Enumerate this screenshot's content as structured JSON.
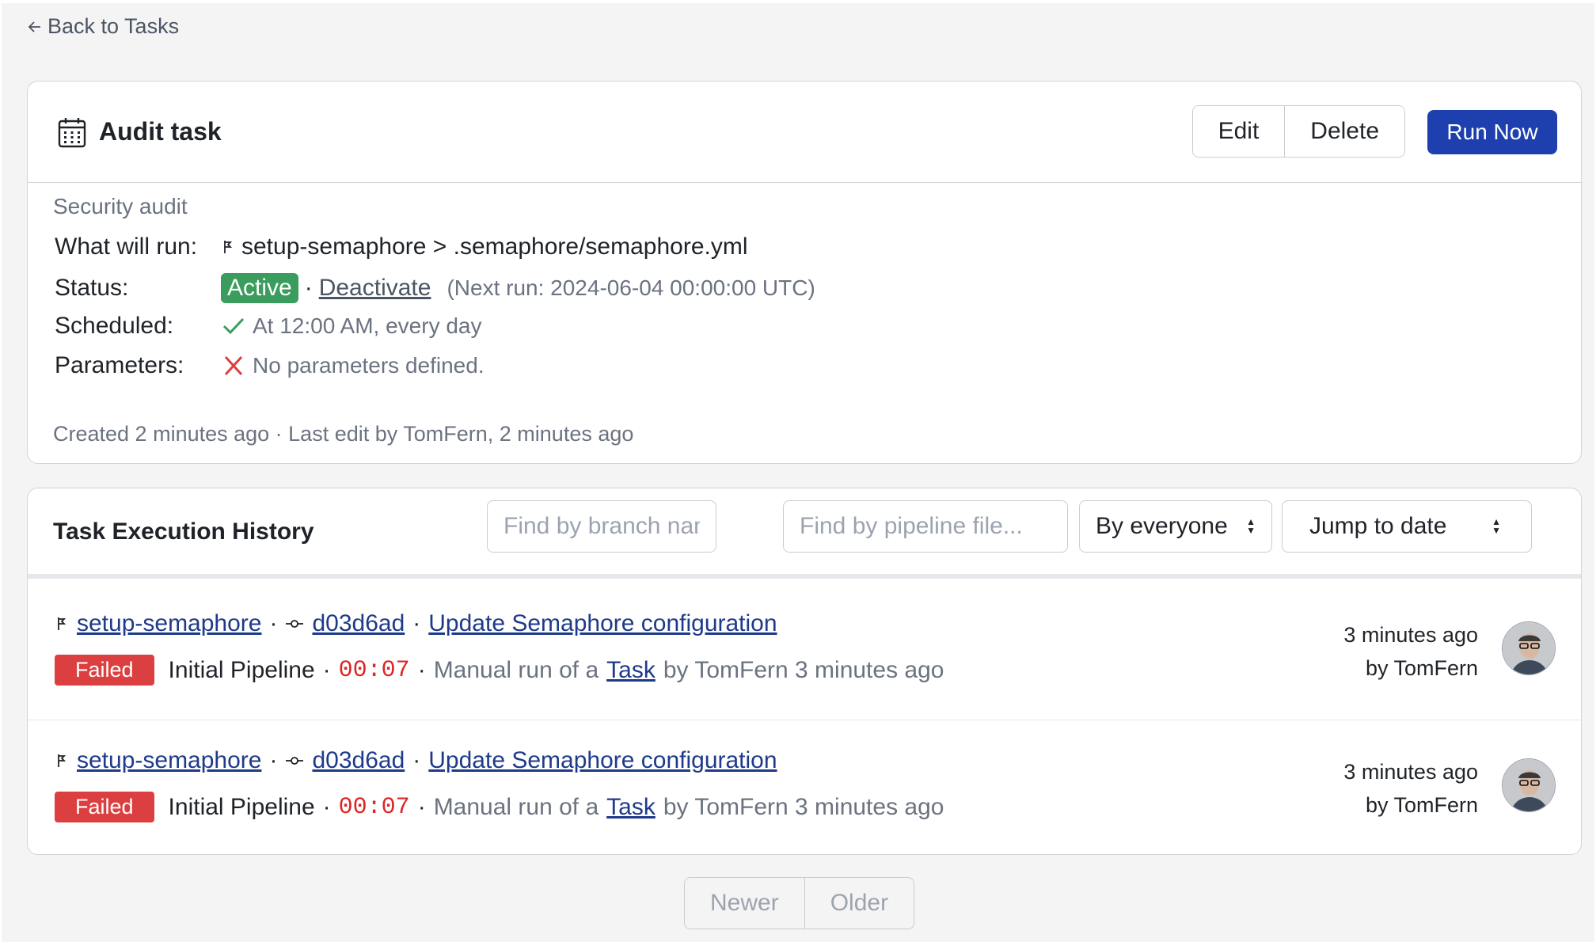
{
  "nav": {
    "back_label": "Back to Tasks"
  },
  "task": {
    "title": "Audit task",
    "edit_label": "Edit",
    "delete_label": "Delete",
    "run_label": "Run Now",
    "description": "Security audit",
    "what_label": "What will run:",
    "what_value": "setup-semaphore > .semaphore/semaphore.yml",
    "status_label": "Status:",
    "status_value": "Active",
    "deactivate_label": "Deactivate",
    "next_run": "(Next run: 2024-06-04 00:00:00 UTC)",
    "scheduled_label": "Scheduled:",
    "scheduled_value": "At 12:00 AM, every day",
    "parameters_label": "Parameters:",
    "parameters_value": "No parameters defined.",
    "meta": "Created 2 minutes ago · Last edit by TomFern, 2 minutes ago"
  },
  "history": {
    "title": "Task Execution History",
    "branch_placeholder": "Find by branch name...",
    "pipeline_placeholder": "Find by pipeline file...",
    "filter_user": "By everyone",
    "jump_date": "Jump to date",
    "runs": [
      {
        "branch": "setup-semaphore",
        "commit": "d03d6ad",
        "message": "Update Semaphore configuration",
        "status": "Failed",
        "pipeline": "Initial Pipeline",
        "duration": "00:07",
        "trigger_prefix": "Manual run of a",
        "trigger_link": "Task",
        "trigger_suffix": "by TomFern 3 minutes ago",
        "time": "3 minutes ago",
        "by": "by TomFern"
      },
      {
        "branch": "setup-semaphore",
        "commit": "d03d6ad",
        "message": "Update Semaphore configuration",
        "status": "Failed",
        "pipeline": "Initial Pipeline",
        "duration": "00:07",
        "trigger_prefix": "Manual run of a",
        "trigger_link": "Task",
        "trigger_suffix": "by TomFern 3 minutes ago",
        "time": "3 minutes ago",
        "by": "by TomFern"
      }
    ]
  },
  "pager": {
    "newer": "Newer",
    "older": "Older"
  },
  "colors": {
    "primary": "#1e40af",
    "active": "#3a9d5d",
    "failed": "#dc3f3f",
    "link": "#1e3a8a"
  }
}
